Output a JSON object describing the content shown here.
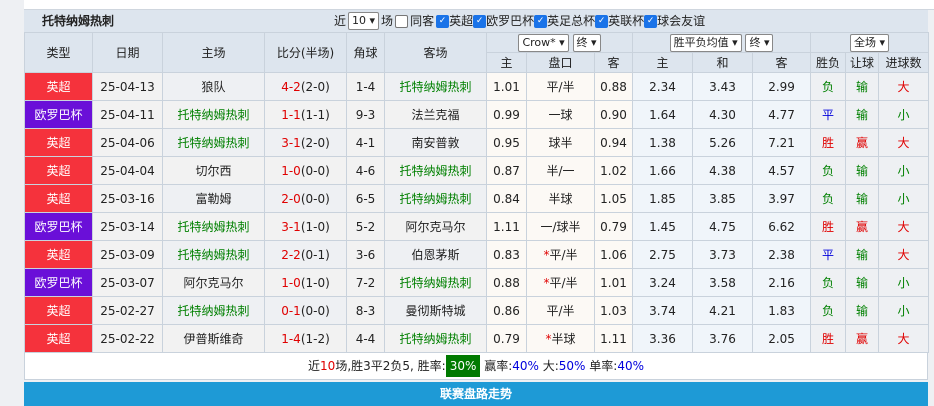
{
  "title": "托特纳姆热刺",
  "filters": {
    "recent_prefix": "近",
    "recent_value": "10",
    "recent_suffix": "场",
    "same_venue": "同客",
    "leagues": [
      "英超",
      "欧罗巴杯",
      "英足总杯",
      "英联杯",
      "球会友谊"
    ]
  },
  "header": {
    "type": "类型",
    "date": "日期",
    "home": "主场",
    "score": "比分(半场)",
    "corner": "角球",
    "away": "客场",
    "company_select": "Crow*",
    "odds_time_select": "终",
    "eu_select": "胜平负均值",
    "eu_time_select": "终",
    "period_select": "全场",
    "sub": [
      "主",
      "盘口",
      "客",
      "主",
      "和",
      "客",
      "胜负",
      "让球",
      "进球数"
    ]
  },
  "colors": {
    "英超": "#f5323c",
    "欧罗巴杯": "#6a0fd8",
    "team_highlight": "#008000",
    "rate_badge": "#007a00",
    "bottom_bar": "#1e9ad6"
  },
  "rows": [
    {
      "league": "英超",
      "date": "25-04-13",
      "home": "狼队",
      "score": "4-2",
      "half": "(2-0)",
      "corner": "1-4",
      "away": "托特纳姆热刺",
      "h": "1.01",
      "line": "平/半",
      "a": "0.88",
      "w": "2.34",
      "d": "3.43",
      "l": "2.99",
      "res": "负",
      "hc": "输",
      "ou": "大"
    },
    {
      "league": "欧罗巴杯",
      "date": "25-04-11",
      "home": "托特纳姆热刺",
      "score": "1-1",
      "half": "(1-1)",
      "corner": "9-3",
      "away": "法兰克福",
      "h": "0.99",
      "line": "一球",
      "a": "0.90",
      "w": "1.64",
      "d": "4.30",
      "l": "4.77",
      "res": "平",
      "hc": "输",
      "ou": "小"
    },
    {
      "league": "英超",
      "date": "25-04-06",
      "home": "托特纳姆热刺",
      "score": "3-1",
      "half": "(2-0)",
      "corner": "4-1",
      "away": "南安普敦",
      "h": "0.95",
      "line": "球半",
      "a": "0.94",
      "w": "1.38",
      "d": "5.26",
      "l": "7.21",
      "res": "胜",
      "hc": "赢",
      "ou": "大"
    },
    {
      "league": "英超",
      "date": "25-04-04",
      "home": "切尔西",
      "score": "1-0",
      "half": "(0-0)",
      "corner": "4-6",
      "away": "托特纳姆热刺",
      "h": "0.87",
      "line": "半/一",
      "a": "1.02",
      "w": "1.66",
      "d": "4.38",
      "l": "4.57",
      "res": "负",
      "hc": "输",
      "ou": "小"
    },
    {
      "league": "英超",
      "date": "25-03-16",
      "home": "富勒姆",
      "score": "2-0",
      "half": "(0-0)",
      "corner": "6-5",
      "away": "托特纳姆热刺",
      "h": "0.84",
      "line": "半球",
      "a": "1.05",
      "w": "1.85",
      "d": "3.85",
      "l": "3.97",
      "res": "负",
      "hc": "输",
      "ou": "小"
    },
    {
      "league": "欧罗巴杯",
      "date": "25-03-14",
      "home": "托特纳姆热刺",
      "score": "3-1",
      "half": "(1-0)",
      "corner": "5-2",
      "away": "阿尔克马尔",
      "h": "1.11",
      "line": "一/球半",
      "a": "0.79",
      "w": "1.45",
      "d": "4.75",
      "l": "6.62",
      "res": "胜",
      "hc": "赢",
      "ou": "大"
    },
    {
      "league": "英超",
      "date": "25-03-09",
      "home": "托特纳姆热刺",
      "score": "2-2",
      "half": "(0-1)",
      "corner": "3-6",
      "away": "伯恩茅斯",
      "h": "0.83",
      "line": "*平/半",
      "a": "1.06",
      "w": "2.75",
      "d": "3.73",
      "l": "2.38",
      "res": "平",
      "hc": "输",
      "ou": "大"
    },
    {
      "league": "欧罗巴杯",
      "date": "25-03-07",
      "home": "阿尔克马尔",
      "score": "1-0",
      "half": "(1-0)",
      "corner": "7-2",
      "away": "托特纳姆热刺",
      "h": "0.88",
      "line": "*平/半",
      "a": "1.01",
      "w": "3.24",
      "d": "3.58",
      "l": "2.16",
      "res": "负",
      "hc": "输",
      "ou": "小"
    },
    {
      "league": "英超",
      "date": "25-02-27",
      "home": "托特纳姆热刺",
      "score": "0-1",
      "half": "(0-0)",
      "corner": "8-3",
      "away": "曼彻斯特城",
      "h": "0.86",
      "line": "平/半",
      "a": "1.03",
      "w": "3.74",
      "d": "4.21",
      "l": "1.83",
      "res": "负",
      "hc": "输",
      "ou": "小"
    },
    {
      "league": "英超",
      "date": "25-02-22",
      "home": "伊普斯维奇",
      "score": "1-4",
      "half": "(1-2)",
      "corner": "4-4",
      "away": "托特纳姆热刺",
      "h": "0.79",
      "line": "*半球",
      "a": "1.11",
      "w": "3.36",
      "d": "3.76",
      "l": "2.05",
      "res": "胜",
      "hc": "赢",
      "ou": "大"
    }
  ],
  "summary": {
    "p1": "近",
    "n": "10",
    "p2": "场,胜3平2负5, 胜率:",
    "win_rate": "30%",
    "p3": " 赢率:",
    "hc_rate": "40%",
    "p4": " 大:",
    "over_rate": "50%",
    "p5": " 单率:",
    "odd_rate": "40%"
  },
  "bottom_bar": "联赛盘路走势"
}
